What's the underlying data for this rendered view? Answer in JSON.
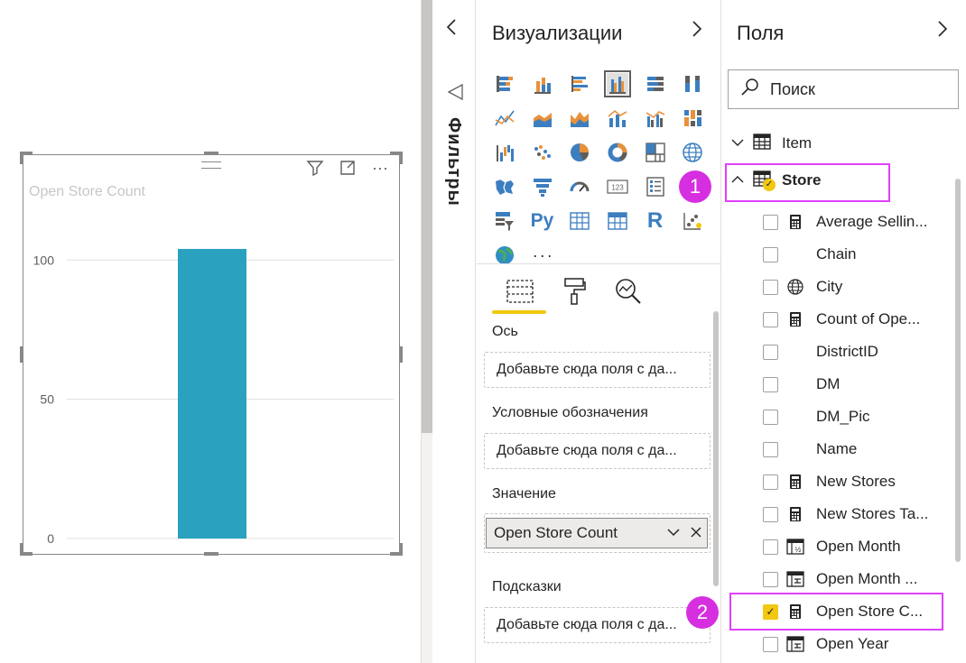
{
  "canvas": {
    "visual": {
      "title": "Open Store Count",
      "header_icons": [
        "filter-icon",
        "focus-mode-icon",
        "more-options-icon"
      ]
    }
  },
  "chart_data": {
    "type": "bar",
    "title": "Open Store Count",
    "categories": [
      ""
    ],
    "values": [
      104
    ],
    "yticks": [
      "0",
      "50",
      "100"
    ],
    "ylim": [
      0,
      115
    ],
    "grid": true,
    "bar_color": "#2aa1bf",
    "xlabel": "",
    "ylabel": ""
  },
  "filters": {
    "label": "Фильтры",
    "collapse_icon": "chevron-left-icon"
  },
  "visualizations": {
    "title": "Визуализации",
    "expand_icon": "chevron-right-icon",
    "more_label": "···",
    "tabs": [
      "fields-tab-icon",
      "format-tab-icon",
      "analytics-tab-icon"
    ],
    "wells": [
      {
        "label": "Ось",
        "placeholder": "Добавьте сюда поля с да..."
      },
      {
        "label": "Условные обозначения",
        "placeholder": "Добавьте сюда поля с да..."
      },
      {
        "label": "Значение",
        "value": "Open Store Count"
      },
      {
        "label": "Подсказки",
        "placeholder": "Добавьте сюда поля с да..."
      }
    ],
    "accent": "#f2c811"
  },
  "fields": {
    "title": "Поля",
    "expand_icon": "chevron-right-icon",
    "search_placeholder": "Поиск",
    "tables": [
      {
        "name": "Item",
        "expanded": false
      },
      {
        "name": "Store",
        "expanded": true
      }
    ],
    "store_fields": [
      {
        "name": "Average Sellin...",
        "icon": "calculator-icon",
        "checked": false
      },
      {
        "name": "Chain",
        "icon": "",
        "checked": false
      },
      {
        "name": "City",
        "icon": "globe-icon",
        "checked": false
      },
      {
        "name": "Count of Ope...",
        "icon": "calculator-icon",
        "checked": false
      },
      {
        "name": "DistrictID",
        "icon": "",
        "checked": false
      },
      {
        "name": "DM",
        "icon": "",
        "checked": false
      },
      {
        "name": "DM_Pic",
        "icon": "",
        "checked": false
      },
      {
        "name": "Name",
        "icon": "",
        "checked": false
      },
      {
        "name": "New Stores",
        "icon": "calculator-icon",
        "checked": false
      },
      {
        "name": "New Stores Ta...",
        "icon": "calculator-icon",
        "checked": false
      },
      {
        "name": "Open Month",
        "icon": "hierarchy-icon",
        "checked": false
      },
      {
        "name": "Open Month ...",
        "icon": "date-hierarchy-icon",
        "checked": false
      },
      {
        "name": "Open Store C...",
        "icon": "calculator-icon",
        "checked": true
      },
      {
        "name": "Open Year",
        "icon": "date-hierarchy-icon",
        "checked": false
      }
    ]
  },
  "callouts": [
    "1",
    "2"
  ],
  "callout_color": "#e040fb"
}
